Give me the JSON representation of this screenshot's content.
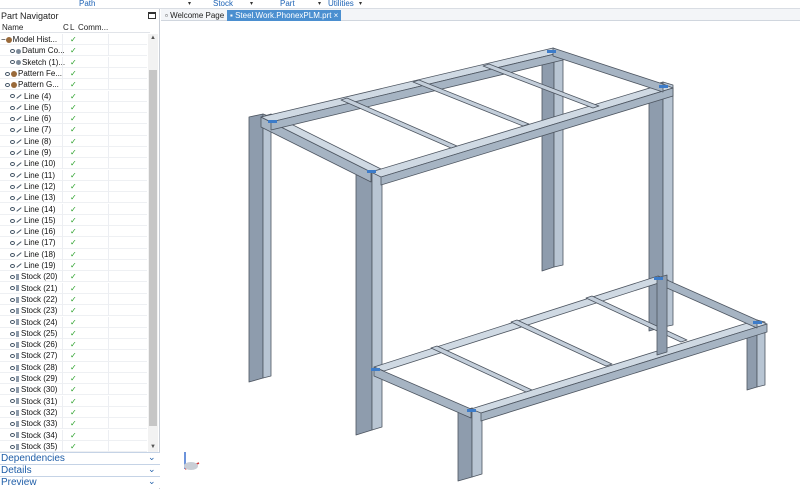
{
  "ribbon": {
    "path": "Path",
    "stock": "Stock",
    "part": "Part",
    "utilities": "Utilities"
  },
  "navigator": {
    "title": "Part Navigator",
    "columns": {
      "name": "Name",
      "c": "C",
      "l": "L",
      "comment": "Comm..."
    },
    "rows": [
      {
        "label": "Model Hist...",
        "icon": "model-history"
      },
      {
        "label": "Datum Co...",
        "icon": "datum"
      },
      {
        "label": "Sketch (1)...",
        "icon": "sketch"
      },
      {
        "label": "Pattern Fe...",
        "icon": "pattern"
      },
      {
        "label": "Pattern G...",
        "icon": "pattern"
      },
      {
        "label": "Line (4)",
        "icon": "line"
      },
      {
        "label": "Line (5)",
        "icon": "line"
      },
      {
        "label": "Line (6)",
        "icon": "line"
      },
      {
        "label": "Line (7)",
        "icon": "line"
      },
      {
        "label": "Line (8)",
        "icon": "line"
      },
      {
        "label": "Line (9)",
        "icon": "line"
      },
      {
        "label": "Line (10)",
        "icon": "line"
      },
      {
        "label": "Line (11)",
        "icon": "line"
      },
      {
        "label": "Line (12)",
        "icon": "line"
      },
      {
        "label": "Line (13)",
        "icon": "line"
      },
      {
        "label": "Line (14)",
        "icon": "line"
      },
      {
        "label": "Line (15)",
        "icon": "line"
      },
      {
        "label": "Line (16)",
        "icon": "line"
      },
      {
        "label": "Line (17)",
        "icon": "line"
      },
      {
        "label": "Line (18)",
        "icon": "line"
      },
      {
        "label": "Line (19)",
        "icon": "line"
      },
      {
        "label": "Stock (20)",
        "icon": "stock"
      },
      {
        "label": "Stock (21)",
        "icon": "stock"
      },
      {
        "label": "Stock (22)",
        "icon": "stock"
      },
      {
        "label": "Stock (23)",
        "icon": "stock"
      },
      {
        "label": "Stock (24)",
        "icon": "stock"
      },
      {
        "label": "Stock (25)",
        "icon": "stock"
      },
      {
        "label": "Stock (26)",
        "icon": "stock"
      },
      {
        "label": "Stock (27)",
        "icon": "stock"
      },
      {
        "label": "Stock (28)",
        "icon": "stock"
      },
      {
        "label": "Stock (29)",
        "icon": "stock"
      },
      {
        "label": "Stock (30)",
        "icon": "stock"
      },
      {
        "label": "Stock (31)",
        "icon": "stock"
      },
      {
        "label": "Stock (32)",
        "icon": "stock"
      },
      {
        "label": "Stock (33)",
        "icon": "stock"
      },
      {
        "label": "Stock (34)",
        "icon": "stock"
      },
      {
        "label": "Stock (35)",
        "icon": "stock"
      }
    ],
    "check_mark": "✓",
    "sections": [
      "Dependencies",
      "Details",
      "Preview"
    ]
  },
  "tabs": {
    "welcome": "Welcome Page",
    "active": "Steel.Work.PhonexPLM.prt"
  },
  "colors": {
    "accent": "#4b8fd0",
    "steel": "#a9b7c6",
    "steel_dark": "#7f8fa0",
    "link": "#1f5ea8"
  }
}
